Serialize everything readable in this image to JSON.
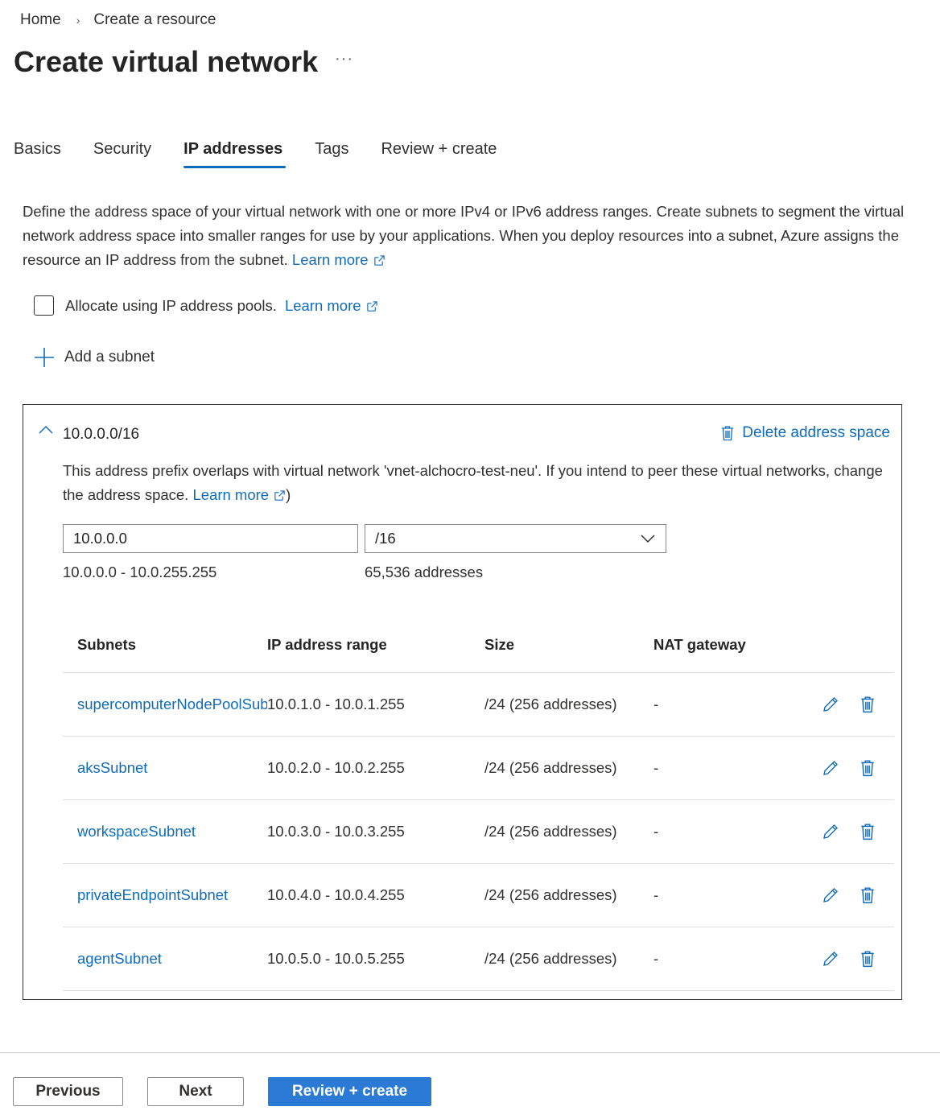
{
  "breadcrumb": {
    "home": "Home",
    "current": "Create a resource"
  },
  "page": {
    "title": "Create virtual network",
    "more": "···"
  },
  "tabs": [
    {
      "label": "Basics"
    },
    {
      "label": "Security"
    },
    {
      "label": "IP addresses"
    },
    {
      "label": "Tags"
    },
    {
      "label": "Review + create"
    }
  ],
  "description": {
    "text": "Define the address space of your virtual network with one or more IPv4 or IPv6 address ranges. Create subnets to segment the virtual network address space into smaller ranges for use by your applications. When you deploy resources into a subnet, Azure assigns the resource an IP address from the subnet.",
    "learn_more": "Learn more"
  },
  "ip_pools": {
    "label": "Allocate using IP address pools.",
    "learn_more": "Learn more"
  },
  "add_subnet": {
    "label": "Add a subnet"
  },
  "address_space": {
    "prefix": "10.0.0.0/16",
    "delete_label": "Delete address space",
    "overlap_warning": "This address prefix overlaps with virtual network 'vnet-alchocro-test-neu'. If you intend to peer these virtual networks, change the address space.",
    "learn_more": "Learn more",
    "closing_paren": ")",
    "ip_value": "10.0.0.0",
    "prefix_length": "/16",
    "range": "10.0.0.0 - 10.0.255.255",
    "count": "65,536 addresses"
  },
  "subnets_table": {
    "headers": {
      "name": "Subnets",
      "range": "IP address range",
      "size": "Size",
      "nat": "NAT gateway"
    },
    "rows": [
      {
        "name": "supercomputerNodePoolSubnet",
        "range": "10.0.1.0 - 10.0.1.255",
        "size": "/24 (256 addresses)",
        "nat": "-"
      },
      {
        "name": "aksSubnet",
        "range": "10.0.2.0 - 10.0.2.255",
        "size": "/24 (256 addresses)",
        "nat": "-"
      },
      {
        "name": "workspaceSubnet",
        "range": "10.0.3.0 - 10.0.3.255",
        "size": "/24 (256 addresses)",
        "nat": "-"
      },
      {
        "name": "privateEndpointSubnet",
        "range": "10.0.4.0 - 10.0.4.255",
        "size": "/24 (256 addresses)",
        "nat": "-"
      },
      {
        "name": "agentSubnet",
        "range": "10.0.5.0 - 10.0.5.255",
        "size": "/24 (256 addresses)",
        "nat": "-"
      }
    ]
  },
  "footer": {
    "previous": "Previous",
    "next": "Next",
    "review": "Review + create"
  },
  "colors": {
    "accent": "#0f6cbd",
    "primary_button": "#2b7bd6",
    "text": "#323130"
  }
}
